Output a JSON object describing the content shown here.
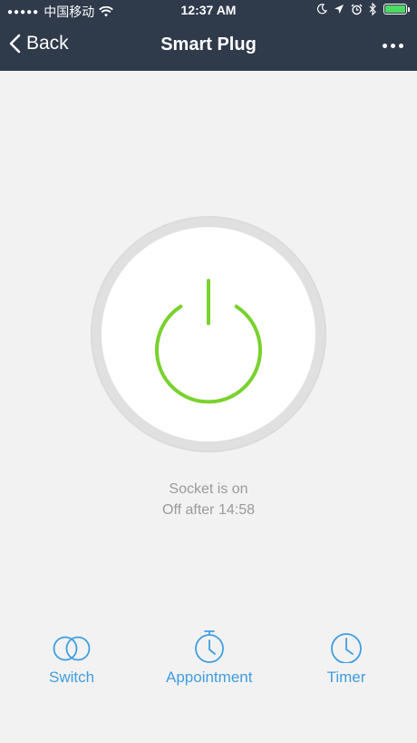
{
  "status_bar": {
    "carrier": "中国移动",
    "time": "12:37 AM"
  },
  "nav": {
    "back_label": "Back",
    "title": "Smart Plug"
  },
  "socket": {
    "status": "Socket is on",
    "timer": "Off after 14:58"
  },
  "tabs": [
    {
      "label": "Switch",
      "icon": "switch-icon"
    },
    {
      "label": "Appointment",
      "icon": "stopwatch-icon"
    },
    {
      "label": "Timer",
      "icon": "clock-icon"
    }
  ],
  "colors": {
    "header_bg": "#2f3a4b",
    "power_green": "#79d12e",
    "accent_blue": "#3f9ee0",
    "battery_green": "#4cd964"
  }
}
